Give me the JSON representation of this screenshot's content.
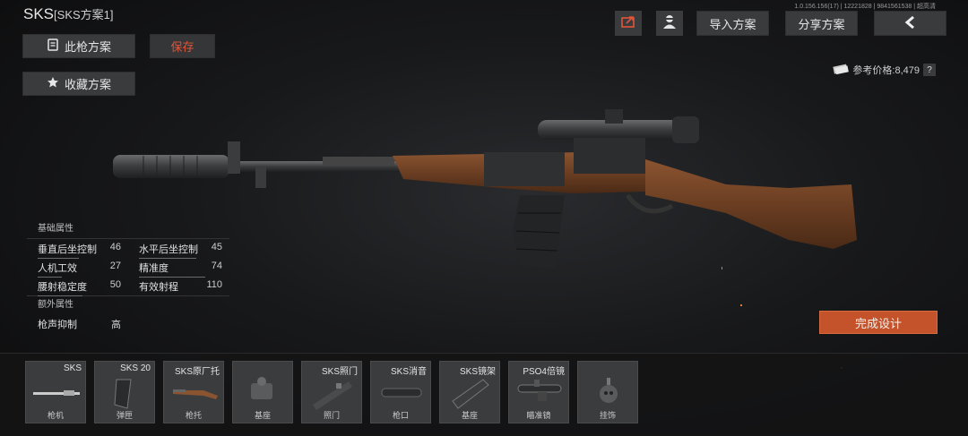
{
  "header": {
    "weapon_name": "SKS",
    "scheme_name": "[SKS方案1]",
    "version": "1.0.156.156(17) | 12221828 | 9841561538 | 超高清"
  },
  "left_buttons": {
    "gun_scheme": "此枪方案",
    "save": "保存",
    "favorite_scheme": "收藏方案"
  },
  "top_right": {
    "import_scheme": "导入方案",
    "share_scheme": "分享方案"
  },
  "price": {
    "label": "参考价格:8,479",
    "help": "?"
  },
  "attributes": {
    "basic_title": "基础属性",
    "items": [
      {
        "label": "垂直后坐控制",
        "value": "46",
        "level": 46
      },
      {
        "label": "水平后坐控制",
        "value": "45",
        "level": 45
      },
      {
        "label": "人机工效",
        "value": "27",
        "level": 27
      },
      {
        "label": "精准度",
        "value": "74",
        "level": 74
      },
      {
        "label": "腰射稳定度",
        "value": "50",
        "level": 50
      },
      {
        "label": "有效射程",
        "value": "110",
        "level": 110
      }
    ],
    "extra_title": "额外属性",
    "extra_items": [
      {
        "label": "枪声抑制",
        "value": "高"
      }
    ]
  },
  "finish_button": "完成设计",
  "slots": [
    {
      "top": "SKS",
      "bottom": "枪机",
      "icon": "receiver-icon"
    },
    {
      "top": "SKS 20",
      "bottom": "弹匣",
      "icon": "magazine-icon"
    },
    {
      "top": "SKS原厂托",
      "bottom": "枪托",
      "icon": "stock-icon"
    },
    {
      "top": "",
      "bottom": "基座",
      "icon": "mount-icon"
    },
    {
      "top": "SKS照门",
      "bottom": "照门",
      "icon": "rear-sight-icon"
    },
    {
      "top": "SKS消音",
      "bottom": "枪口",
      "icon": "suppressor-icon"
    },
    {
      "top": "SKS镜架",
      "bottom": "基座",
      "icon": "scope-mount-icon"
    },
    {
      "top": "PSO4倍镜",
      "bottom": "瞄准镜",
      "icon": "scope-icon"
    },
    {
      "top": "",
      "bottom": "挂饰",
      "icon": "charm-icon"
    }
  ],
  "colors": {
    "accent": "#c4532b",
    "save_text": "#e2553a",
    "button_bg": "#3a3b3d"
  }
}
